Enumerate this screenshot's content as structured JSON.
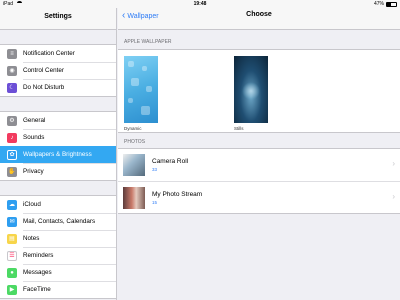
{
  "status": {
    "device": "iPad",
    "time": "19:48",
    "battery": "47%"
  },
  "sidebar": {
    "title": "Settings",
    "groups": [
      [
        {
          "label": "Notification Center",
          "icon": "notification-icon",
          "color": "#8e8e93"
        },
        {
          "label": "Control Center",
          "icon": "control-center-icon",
          "color": "#8e8e93"
        },
        {
          "label": "Do Not Disturb",
          "icon": "moon-icon",
          "color": "#6c4fd6"
        }
      ],
      [
        {
          "label": "General",
          "icon": "gear-icon",
          "color": "#8e8e93"
        },
        {
          "label": "Sounds",
          "icon": "speaker-icon",
          "color": "#f23b5f"
        },
        {
          "label": "Wallpapers & Brightness",
          "icon": "wallpaper-icon",
          "color": "#2e9ef0",
          "selected": true
        },
        {
          "label": "Privacy",
          "icon": "hand-icon",
          "color": "#8e8e93"
        }
      ],
      [
        {
          "label": "iCloud",
          "icon": "cloud-icon",
          "color": "#2e9ef0"
        },
        {
          "label": "Mail, Contacts, Calendars",
          "icon": "mail-icon",
          "color": "#2e9ef0"
        },
        {
          "label": "Notes",
          "icon": "notes-icon",
          "color": "#f7d54a"
        },
        {
          "label": "Reminders",
          "icon": "reminders-icon",
          "color": "#ffffff"
        },
        {
          "label": "Messages",
          "icon": "messages-icon",
          "color": "#4cd964"
        },
        {
          "label": "FaceTime",
          "icon": "facetime-icon",
          "color": "#4cd964"
        }
      ]
    ]
  },
  "nav": {
    "back_label": "Wallpaper",
    "title": "Choose"
  },
  "apple_wallpaper": {
    "section_label": "APPLE WALLPAPER",
    "items": [
      {
        "caption": "Dynamic"
      },
      {
        "caption": "Stills"
      }
    ]
  },
  "photos": {
    "section_label": "PHOTOS",
    "albums": [
      {
        "name": "Camera Roll",
        "count": "33"
      },
      {
        "name": "My Photo Stream",
        "count": "15"
      }
    ]
  },
  "colors": {
    "accent": "#2e7cf6",
    "selected_row": "#33a8f2"
  }
}
